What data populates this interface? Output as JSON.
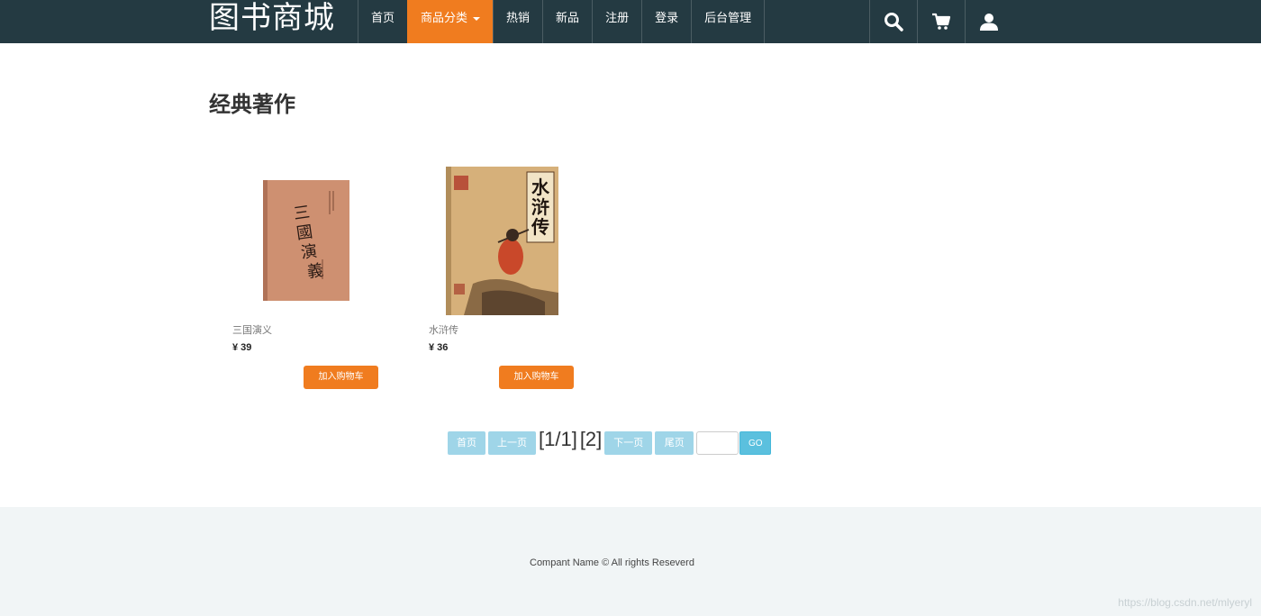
{
  "brand": "图书商城",
  "nav": {
    "items": [
      "首页",
      "商品分类",
      "热销",
      "新品",
      "注册",
      "登录",
      "后台管理"
    ],
    "active_index": 1,
    "icons": [
      "search-icon",
      "cart-icon",
      "user-icon"
    ]
  },
  "colors": {
    "nav_bg": "#243a42",
    "accent": "#f07c1f",
    "pager_btn": "#9fd5e8",
    "go_btn": "#5bc0de",
    "footer_bg": "#f1f5f6"
  },
  "section": {
    "title": "经典著作"
  },
  "products": [
    {
      "name": "三国演义",
      "price": "¥ 39",
      "button": "加入购物车",
      "cover_title": "三國演義"
    },
    {
      "name": "水浒传",
      "price": "¥ 36",
      "button": "加入购物车",
      "cover_title": "水浒传"
    }
  ],
  "pagination": {
    "first": "首页",
    "prev": "上一页",
    "pages": [
      "[1/1]",
      "[2]"
    ],
    "next": "下一页",
    "last": "尾页",
    "go": "GO"
  },
  "footer": {
    "text": "Compant Name © All rights Reseverd"
  },
  "watermark": "https://blog.csdn.net/mlyeryl"
}
